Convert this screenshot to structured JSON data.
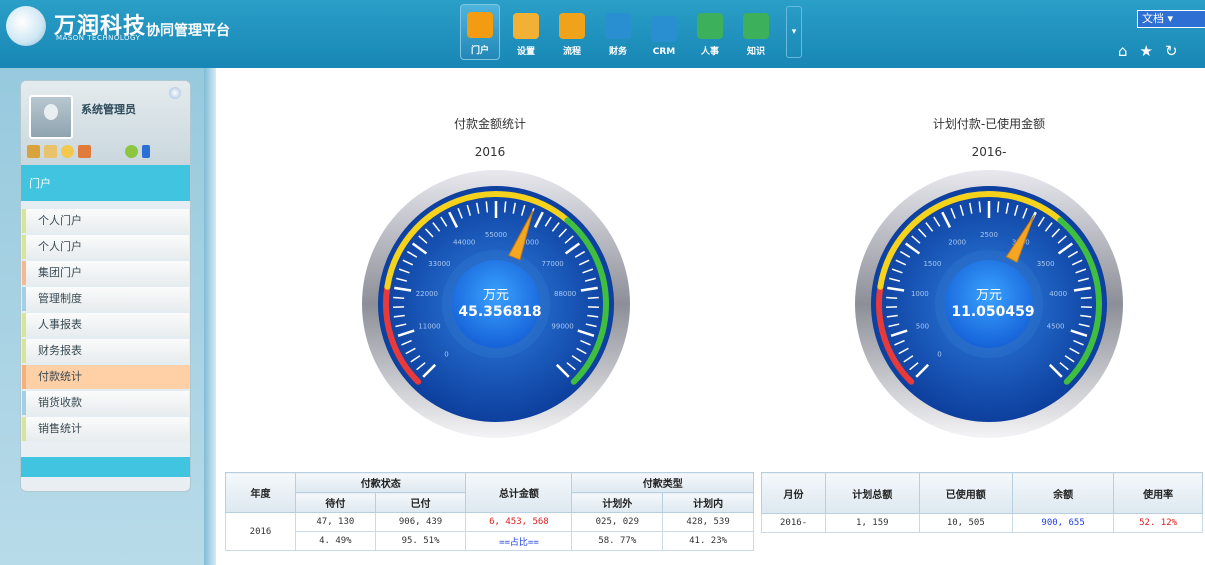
{
  "header": {
    "title": "万润科技",
    "subtitle": "MASON TECHNOLOGY",
    "platform": "协同管理平台",
    "nav": [
      {
        "label": "门户",
        "icon": "home-icon",
        "color": "#f39c12",
        "active": true
      },
      {
        "label": "设置",
        "icon": "wrench-icon",
        "color": "#f2b134",
        "active": false
      },
      {
        "label": "流程",
        "icon": "flow-chart-icon",
        "color": "#f0a21a",
        "active": false
      },
      {
        "label": "财务",
        "icon": "finance-icon",
        "color": "#2a8fd0",
        "active": false
      },
      {
        "label": "CRM",
        "icon": "crm-icon",
        "color": "#2a8fd0",
        "active": false
      },
      {
        "label": "人事",
        "icon": "hr-icon",
        "color": "#3cb05a",
        "active": false
      },
      {
        "label": "知识",
        "icon": "knowledge-icon",
        "color": "#3cb05a",
        "active": false
      }
    ],
    "doc_select": "文档"
  },
  "sidebar": {
    "username": "系统管理员",
    "section": "门户",
    "items": [
      {
        "label": "个人门户",
        "bar": "#d6e59a"
      },
      {
        "label": "个人门户",
        "bar": "#d6e59a"
      },
      {
        "label": "集团门户",
        "bar": "#f5b893"
      },
      {
        "label": "管理制度",
        "bar": "#9fd0e6"
      },
      {
        "label": "人事报表",
        "bar": "#d6e59a"
      },
      {
        "label": "财务报表",
        "bar": "#d6e59a"
      },
      {
        "label": "付款统计",
        "bar": "#f8b07a",
        "active": true
      },
      {
        "label": "销货收款",
        "bar": "#9fd0e6"
      },
      {
        "label": "销售统计",
        "bar": "#d6e59a"
      }
    ]
  },
  "gauge1": {
    "title": "付款金额统计",
    "subtitle": "2016",
    "unit": "万元",
    "value_text": "45.356818",
    "ticks": [
      "0",
      "11000",
      "22000",
      "33000",
      "44000",
      "55000",
      "66000",
      "77000",
      "88000",
      "99000"
    ],
    "tick_max": 110000,
    "needle": 0.58
  },
  "gauge2": {
    "title": "计划付款-已使用金额",
    "subtitle": "2016-",
    "unit": "万元",
    "value_text": "11.050459",
    "ticks": [
      "0",
      "500",
      "1000",
      "1500",
      "2000",
      "2500",
      "3000",
      "3500",
      "4000",
      "4500"
    ],
    "tick_max": 5000,
    "needle": 0.6
  },
  "table1": {
    "h_year": "年度",
    "h_status": "付款状态",
    "h_unpaid": "待付",
    "h_paid": "已付",
    "h_total": "总计金额",
    "h_type": "付款类型",
    "h_outplan": "计划外",
    "h_inplan": "计划内",
    "year": "2016",
    "unpaid": "47, 130",
    "paid": "906, 439",
    "total": "6, 453, 568",
    "outplan": "025, 029",
    "inplan": "428, 539",
    "unpaid_pct": "4. 49%",
    "paid_pct": "95. 51%",
    "ratio_label": "==占比==",
    "outplan_pct": "58. 77%",
    "inplan_pct": "41. 23%"
  },
  "table2": {
    "h_month": "月份",
    "h_plan_total": "计划总额",
    "h_used": "已使用额",
    "h_balance": "余额",
    "h_rate": "使用率",
    "month": "2016-",
    "plan_total": "1, 159",
    "used": "10, 505",
    "balance": "900, 655",
    "rate": "52. 12%"
  }
}
